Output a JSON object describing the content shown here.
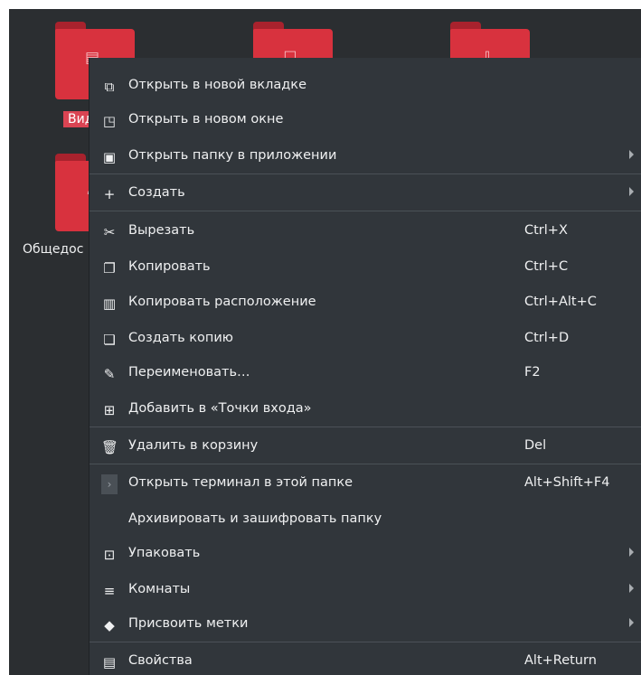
{
  "desktop": {
    "folders": [
      {
        "icon": "video-icon",
        "label": "Вид",
        "selected": true
      },
      {
        "icon": "document-icon",
        "label": ""
      },
      {
        "icon": "download-icon",
        "label": ""
      },
      {
        "icon": "user-icon",
        "label": "Общедос",
        "selected": false
      }
    ]
  },
  "context_menu": {
    "items": [
      {
        "icon": "new-tab-icon",
        "label": "Открыть в новой вкладке",
        "shortcut": "",
        "submenu": false
      },
      {
        "icon": "new-window-icon",
        "label": "Открыть в новом окне",
        "shortcut": "",
        "submenu": false
      },
      {
        "icon": "open-with-icon",
        "label": "Открыть папку в приложении",
        "shortcut": "",
        "submenu": true
      },
      {
        "icon": "plus-icon",
        "label": "Создать",
        "shortcut": "",
        "submenu": true
      },
      {
        "icon": "cut-icon",
        "label": "Вырезать",
        "shortcut": "Ctrl+X",
        "submenu": false
      },
      {
        "icon": "copy-icon",
        "label": "Копировать",
        "shortcut": "Ctrl+C",
        "submenu": false
      },
      {
        "icon": "copy-location-icon",
        "label": "Копировать расположение",
        "shortcut": "Ctrl+Alt+C",
        "submenu": false
      },
      {
        "icon": "duplicate-icon",
        "label": "Создать копию",
        "shortcut": "Ctrl+D",
        "submenu": false
      },
      {
        "icon": "rename-icon",
        "label": "Переименовать…",
        "shortcut": "F2",
        "submenu": false
      },
      {
        "icon": "bookmark-add-icon",
        "label": "Добавить в «Точки входа»",
        "shortcut": "",
        "submenu": false
      },
      {
        "icon": "trash-icon",
        "label": "Удалить в корзину",
        "shortcut": "Del",
        "submenu": false
      },
      {
        "icon": "terminal-icon",
        "label": "Открыть терминал в этой папке",
        "shortcut": "Alt+Shift+F4",
        "submenu": false
      },
      {
        "icon": "",
        "label": "Архивировать и зашифровать папку",
        "shortcut": "",
        "submenu": false
      },
      {
        "icon": "archive-icon",
        "label": "Упаковать",
        "shortcut": "",
        "submenu": true
      },
      {
        "icon": "activities-icon",
        "label": "Комнаты",
        "shortcut": "",
        "submenu": true
      },
      {
        "icon": "tag-icon",
        "label": "Присвоить метки",
        "shortcut": "",
        "submenu": true
      },
      {
        "icon": "properties-icon",
        "label": "Свойства",
        "shortcut": "Alt+Return",
        "submenu": false
      }
    ]
  },
  "colors": {
    "background": "#2b2e31",
    "menu_background": "#31363b",
    "folder": "#d8323e",
    "selection": "#da4453",
    "text": "#eff0f1"
  }
}
